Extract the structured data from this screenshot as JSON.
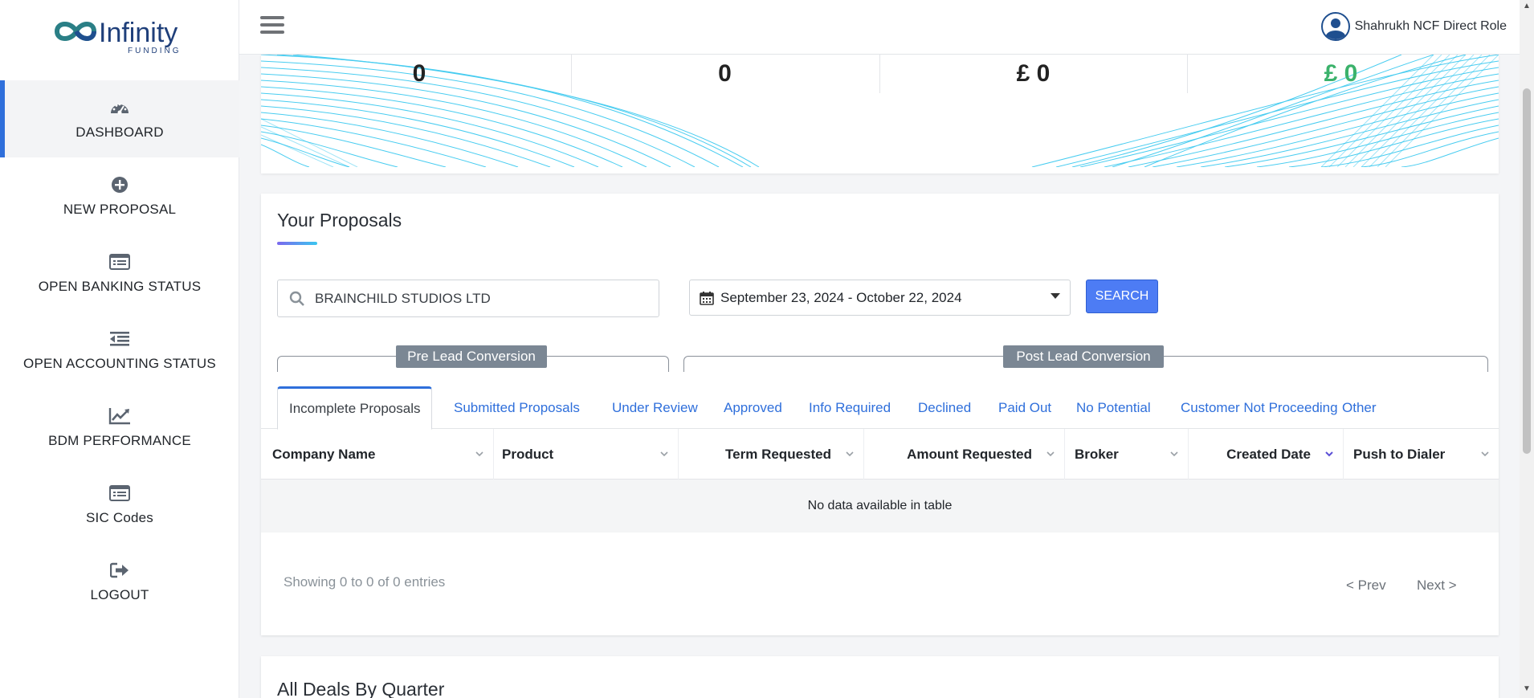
{
  "brand": {
    "name": "Infinity",
    "tagline": "FUNDING"
  },
  "sidebar": {
    "items": [
      {
        "label": "DASHBOARD",
        "icon": "dashboard-icon",
        "active": true
      },
      {
        "label": "NEW PROPOSAL",
        "icon": "plus-circle-icon"
      },
      {
        "label": "OPEN BANKING STATUS",
        "icon": "list-card-icon"
      },
      {
        "label": "OPEN ACCOUNTING STATUS",
        "icon": "indent-list-icon"
      },
      {
        "label": "BDM PERFORMANCE",
        "icon": "chart-line-icon"
      },
      {
        "label": "SIC Codes",
        "icon": "list-card-icon"
      },
      {
        "label": "LOGOUT",
        "icon": "logout-icon"
      }
    ]
  },
  "topbar": {
    "user_name": "Shahrukh NCF Direct Role"
  },
  "stats": [
    {
      "value": "0"
    },
    {
      "value": "0"
    },
    {
      "value": "£ 0"
    },
    {
      "value": "£ 0",
      "color": "#3bb26b"
    }
  ],
  "proposals": {
    "title": "Your Proposals",
    "search_value": "BRAINCHILD STUDIOS LTD",
    "date_range": "September 23, 2024 - October 22, 2024",
    "search_button": "SEARCH",
    "groups": {
      "pre": "Pre Lead Conversion",
      "post": "Post Lead Conversion"
    },
    "tabs": [
      "Incomplete Proposals",
      "Submitted Proposals",
      "Under Review",
      "Approved",
      "Info Required",
      "Declined",
      "Paid Out",
      "No Potential",
      "Customer Not Proceeding",
      "Other"
    ],
    "columns": [
      "Company Name",
      "Product",
      "Term Requested",
      "Amount Requested",
      "Broker",
      "Created Date",
      "Push to Dialer"
    ],
    "empty_message": "No data available in table",
    "entries_info": "Showing 0 to 0 of 0 entries",
    "pager": {
      "prev": "<  Prev",
      "next": "Next  >"
    }
  },
  "deals": {
    "title": "All Deals By Quarter"
  },
  "colors": {
    "accent": "#2f6fdb",
    "button": "#4d7cf4",
    "wave": "#29c4ee",
    "positive": "#3bb26b"
  }
}
